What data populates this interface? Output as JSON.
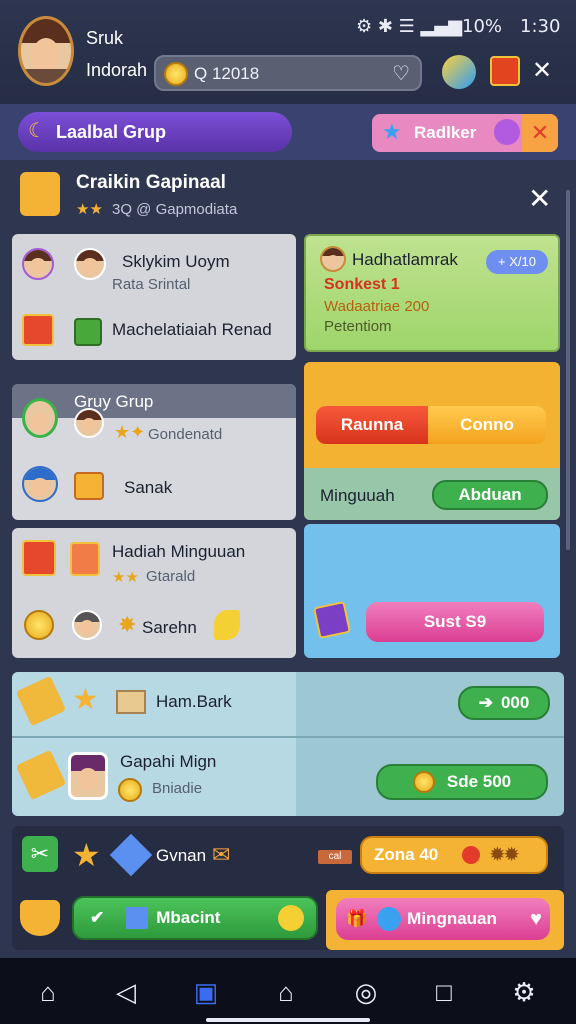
{
  "status": {
    "battery": "10%",
    "time": "1:30"
  },
  "profile": {
    "name": "Sruk",
    "subtitle": "Indorah"
  },
  "search": {
    "value": "Q 12018"
  },
  "group_bar": {
    "title": "Laalbal Grup",
    "badge": "Radlker"
  },
  "panel": {
    "title": "Craikin Gapinaal",
    "subtitle": "3Q @ Gapmodiata"
  },
  "card_a": {
    "line1": "Sklykim Uoym",
    "line2": "Rata Srintal",
    "line3": "Machelatiaiah Renad"
  },
  "card_b": {
    "title": "Hadhatlamrak",
    "badge": "+ X/10",
    "line1": "Sonkest 1",
    "line2": "Wadaatriae 200",
    "line3": "Petentiom"
  },
  "card_c": {
    "title": "Gruy Grup",
    "sub": "Gondenatd",
    "line": "Sanak"
  },
  "card_d": {
    "btn_left": "Raunna",
    "btn_right": "Conno",
    "label": "Minguuah",
    "btn_green": "Abduan"
  },
  "card_e": {
    "title": "Hadiah Minguuan",
    "sub": "Gtarald",
    "line": "Sarehn"
  },
  "card_f": {
    "btn": "Sust S9"
  },
  "row1": {
    "label": "Ham.Bark",
    "btn": "000"
  },
  "row2": {
    "title": "Gapahi Mign",
    "sub": "Bniadie",
    "btn": "Sde 500"
  },
  "footer1": {
    "label": "Gvnan",
    "tag": "cal",
    "btn": "Zona 40"
  },
  "footer2": {
    "btn_green": "Mbacint",
    "btn_pink": "Mingnauan"
  },
  "nav": [
    "home-icon",
    "back-icon",
    "apps-icon",
    "house-icon",
    "compass-icon",
    "square-icon",
    "settings-icon"
  ],
  "colors": {
    "accent_purple": "#6b3fc1",
    "gold": "#f4b335",
    "green": "#3eb04d",
    "pink": "#e54ea0",
    "blue_panel": "#73c0ec"
  }
}
